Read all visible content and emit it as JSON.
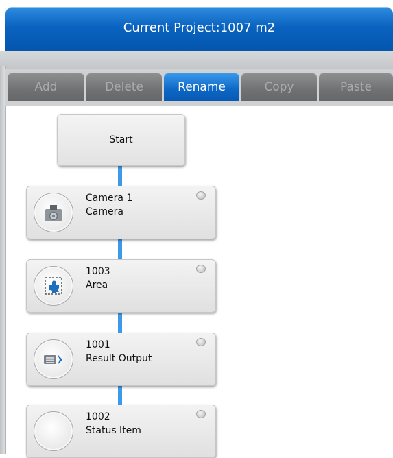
{
  "header": {
    "title": "Current Project:1007   m2"
  },
  "toolbar": {
    "buttons": [
      {
        "label": "Add",
        "state": "disabled"
      },
      {
        "label": "Delete",
        "state": "disabled"
      },
      {
        "label": "Rename",
        "state": "active"
      },
      {
        "label": "Copy",
        "state": "disabled"
      },
      {
        "label": "Paste",
        "state": "disabled"
      }
    ]
  },
  "flow": {
    "start_label": "Start",
    "nodes": [
      {
        "id": "Camera 1",
        "name": "Camera",
        "icon": "camera-icon"
      },
      {
        "id": "1003",
        "name": "Area",
        "icon": "area-puzzle-icon"
      },
      {
        "id": "1001",
        "name": "Result Output",
        "icon": "result-output-icon"
      },
      {
        "id": "1002",
        "name": "Status Item",
        "icon": "status-item-icon"
      }
    ]
  },
  "colors": {
    "accent": "#0a63c0",
    "connector": "#3d9ae8",
    "disabled_button": "#6f7173"
  }
}
